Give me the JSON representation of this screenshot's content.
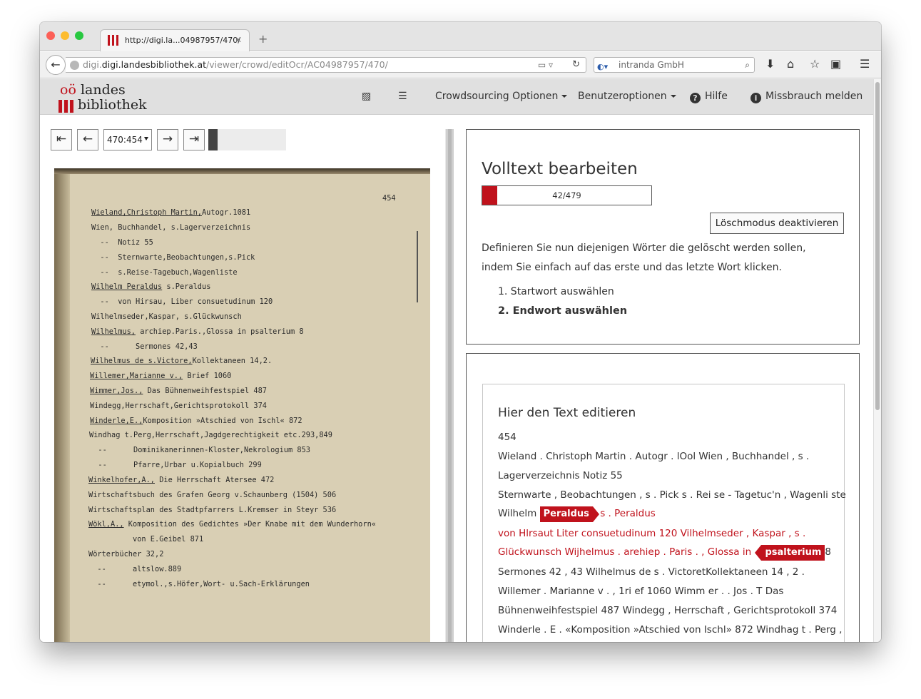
{
  "browser": {
    "tab_title": "http://digi.la...04987957/470/",
    "url_host": "digi.landesbibliothek.at",
    "url_path": "/viewer/crowd/editOcr/AC04987957/470/",
    "url_prefix": "digi.",
    "search_engine": "intranda GmbH"
  },
  "site": {
    "logo_line1_a": "oö",
    "logo_line1_b": "landes",
    "logo_line2": "bibliothek",
    "menu": {
      "crowdsourcing": "Crowdsourcing Optionen",
      "user": "Benutzeroptionen",
      "help": "Hilfe",
      "report": "Missbrauch melden"
    }
  },
  "viewer": {
    "page_select": "470:454",
    "page_number": "454",
    "progress_fraction": 0.12,
    "scan_lines": [
      {
        "u": "Wieland,Christoph Martin,",
        "t": "Autogr.1081"
      },
      {
        "u": "",
        "t": "Wien, Buchhandel, s.Lagerverzeichnis"
      },
      {
        "u": "",
        "t": "  --  Notiz 55"
      },
      {
        "u": "",
        "t": "  --  Sternwarte,Beobachtungen,s.Pick"
      },
      {
        "u": "",
        "t": "  --  s.Reise-Tagebuch,Wagenliste"
      },
      {
        "u": "Wilhelm Peraldus",
        "t": " s.Peraldus"
      },
      {
        "u": "",
        "t": "  --  von Hirsau, Liber consuetudinum 120"
      },
      {
        "u": "",
        "t": "Wilhelmseder,Kaspar, s.Glückwunsch"
      },
      {
        "u": "Wilhelmus,",
        "t": " archiep.Paris.,Glossa in psalterium 8"
      },
      {
        "u": "",
        "t": "  --      Sermones 42,43"
      },
      {
        "u": "Wilhelmus de s.Victore,",
        "t": "Kollektaneen 14,2."
      },
      {
        "u": "Willemer,Marianne v.,",
        "t": " Brief 1060"
      },
      {
        "u": "Wimmer,Jos.,",
        "t": " Das Bühnenweihfestspiel 487"
      },
      {
        "u": "",
        "t": "Windegg,Herrschaft,Gerichtsprotokoll 374"
      },
      {
        "u": "Winderle,E.,",
        "t": "Komposition »Atschied von Ischl« 872"
      },
      {
        "u": "",
        "t": "Windhag t.Perg,Herrschaft,Jagdgerechtigkeit etc.293,849"
      },
      {
        "u": "",
        "t": "  --      Dominikanerinnen-Kloster,Nekrologium 853"
      },
      {
        "u": "",
        "t": "  --      Pfarre,Urbar u.Kopialbuch 299"
      },
      {
        "u": "Winkelhofer,A.,",
        "t": " Die Herrschaft Atersee 472"
      },
      {
        "u": "",
        "t": "Wirtschaftsbuch des Grafen Georg v.Schaunberg (1504) 506"
      },
      {
        "u": "",
        "t": "Wirtschaftsplan des Stadtpfarrers L.Kremser in Steyr 536"
      },
      {
        "u": "Wökl,A.,",
        "t": " Komposition des Gedichtes »Der Knabe mit dem Wunderhorn«"
      },
      {
        "u": "",
        "t": "          von E.Geibel 871"
      },
      {
        "u": "",
        "t": "Wörterbücher 32,2"
      },
      {
        "u": "",
        "t": "  --      altslow.889"
      },
      {
        "u": "",
        "t": "  --      etymol.,s.Höfer,Wort- u.Sach-Erklärungen"
      }
    ]
  },
  "editor": {
    "title": "Volltext bearbeiten",
    "progress_label": "42/479",
    "progress_fraction": 0.088,
    "delete_mode_button": "Löschmodus deaktivieren",
    "description": "Definieren Sie nun diejenigen Wörter die gelöscht werden sollen, indem Sie einfach auf das erste und das letzte Wort klicken.",
    "step1": "1. Startwort auswählen",
    "step2": "2. Endwort auswählen",
    "text_heading": "Hier den Text editieren",
    "text": {
      "l1": "454",
      "l2": "Wieland . Christoph Martin . Autogr . lOol Wien , Buchhandel , s .",
      "l3": "Lagerverzeichnis Notiz 55",
      "l4": "Sternwarte , Beobachtungen , s . Pick s . Rei se - Tagetuc'n , Wagenli ste",
      "l5_pre": "Wilhelm",
      "l5_tag": "Peraldus",
      "l5_post": "s . Peraldus",
      "l6": "von Hlrsaut Liter consuetudinum 120 Vilhelmseder , Kaspar , s .",
      "l7_pre": "Glückwunsch Wijhelmus . arehiep . Paris . , Glossa in",
      "l7_tag": "psalterium",
      "l7_post": "8",
      "l8": "Sermones 42 , 43 Wilhelmus de s . VictoretKollektaneen 14 , 2 .",
      "l9": "Willemer . Marianne v . , 1ri ef 1060 Wimm er . . Jos . T Das",
      "l10": "Bühnenweihfestspiel 487 Windegg , Herrschaft , Gerichtsprotokoll 374",
      "l11": "Winderle . E . «Komposition »Atschied von Ischl» 872 Windhag t . Perg ,"
    }
  }
}
